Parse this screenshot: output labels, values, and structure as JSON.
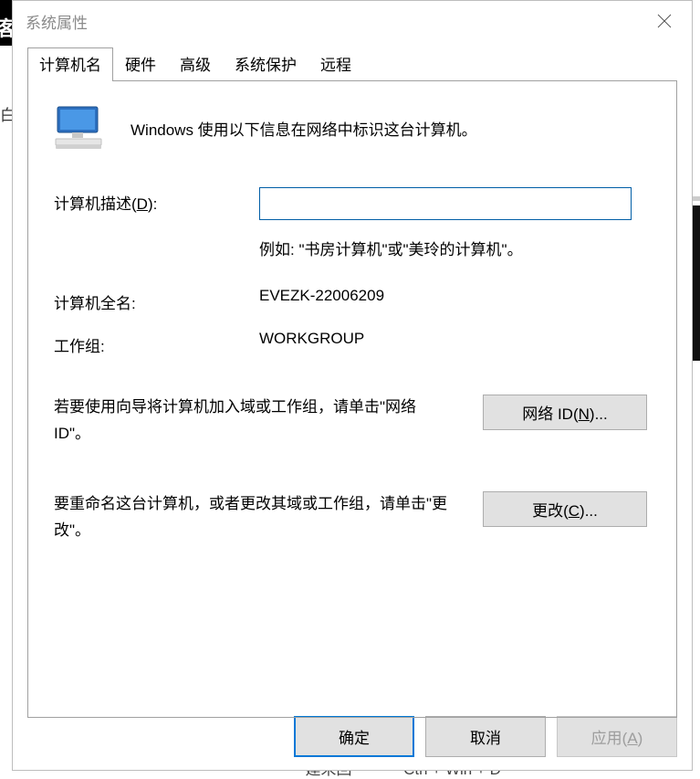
{
  "window": {
    "title": "系统属性"
  },
  "tabs": {
    "items": [
      {
        "label": "计算机名"
      },
      {
        "label": "硬件"
      },
      {
        "label": "高级"
      },
      {
        "label": "系统保护"
      },
      {
        "label": "远程"
      }
    ]
  },
  "page": {
    "intro": "Windows 使用以下信息在网络中标识这台计算机。",
    "desc_label_pre": "计算机描述(",
    "desc_label_key": "D",
    "desc_label_post": "):",
    "desc_value": "",
    "desc_hint": "例如: \"书房计算机\"或\"美玲的计算机\"。",
    "fullname_label": "计算机全名:",
    "fullname_value": "EVEZK-22006209",
    "workgroup_label": "工作组:",
    "workgroup_value": "WORKGROUP",
    "netid_text": "若要使用向导将计算机加入域或工作组，请单击\"网络 ID\"。",
    "netid_button_pre": "网络 ID(",
    "netid_button_key": "N",
    "netid_button_post": ")...",
    "change_text": "要重命名这台计算机，或者更改其域或工作组，请单击\"更改\"。",
    "change_button_pre": "更改(",
    "change_button_key": "C",
    "change_button_post": ")..."
  },
  "footer": {
    "ok": "确定",
    "cancel": "取消",
    "apply_pre": "应用(",
    "apply_key": "A",
    "apply_post": ")"
  },
  "bg": {
    "left_char": "客",
    "left_small": "白",
    "bottom_hint_left": "建未回",
    "bottom_hint_right": "  Ctrl + Win + D"
  },
  "icons": {
    "computer": "computer-icon",
    "close": "close-icon"
  }
}
